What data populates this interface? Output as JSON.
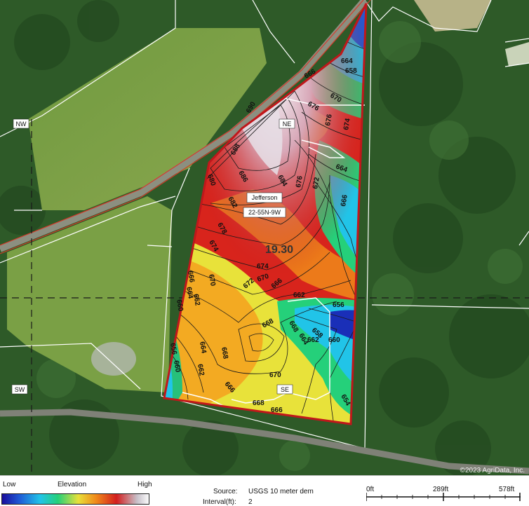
{
  "map": {
    "field_id": "19.30",
    "county_label": "Jefferson",
    "township_label": "22-55N-9W",
    "direction_labels": {
      "nw": "NW",
      "ne": "NE",
      "sw": "SW",
      "se": "SE"
    },
    "copyright": "©2023 AgriData, Inc.",
    "contour_labels": [
      "690",
      "688",
      "686",
      "684",
      "682",
      "680",
      "678",
      "676",
      "674",
      "672",
      "670",
      "668",
      "666",
      "664",
      "662",
      "660",
      "658",
      "656",
      "654"
    ],
    "colors": {
      "boundary": "#c0171b",
      "road": "#d63a2a",
      "section_line": "#1a1a1a"
    }
  },
  "legend": {
    "low_label": "Low",
    "title": "Elevation",
    "high_label": "High",
    "source_label": "Source:",
    "source_value": "USGS 10 meter dem",
    "interval_label": "Interval(ft):",
    "interval_value": "2",
    "scale": {
      "tick0": "0ft",
      "tick1": "289ft",
      "tick2": "578ft"
    }
  }
}
